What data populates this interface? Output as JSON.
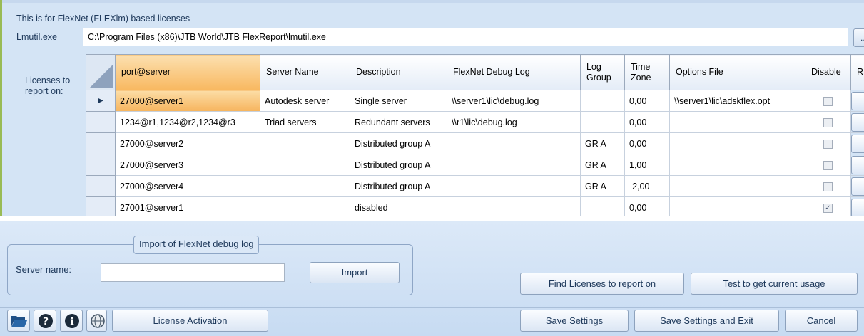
{
  "top": {
    "info_text": "This is for FlexNet (FLEXlm) based licenses",
    "lmutil_label": "Lmutil.exe",
    "lmutil_path": "C:\\Program Files (x86)\\JTB World\\JTB FlexReport\\lmutil.exe",
    "browse_label": "...",
    "licenses_label_line1": "Licenses to",
    "licenses_label_line2": "report on:"
  },
  "grid": {
    "columns": [
      {
        "line1": "port@server",
        "line2": ""
      },
      {
        "line1": "Server Name",
        "line2": ""
      },
      {
        "line1": "Description",
        "line2": ""
      },
      {
        "line1": "FlexNet Debug Log",
        "line2": ""
      },
      {
        "line1": "Log",
        "line2": "Group"
      },
      {
        "line1": "Time",
        "line2": "Zone"
      },
      {
        "line1": "Options File",
        "line2": ""
      },
      {
        "line1": "Disable",
        "line2": ""
      },
      {
        "line1": "R",
        "line2": ""
      }
    ],
    "rows": [
      {
        "port": "27000@server1",
        "server": "Autodesk server",
        "desc": "Single server",
        "log": "\\\\server1\\lic\\debug.log",
        "group": "",
        "tz": "0,00",
        "options": "\\\\server1\\lic\\adskflex.opt",
        "disabled": false
      },
      {
        "port": "1234@r1,1234@r2,1234@r3",
        "server": "Triad servers",
        "desc": "Redundant servers",
        "log": "\\\\r1\\lic\\debug.log",
        "group": "",
        "tz": "0,00",
        "options": "",
        "disabled": false
      },
      {
        "port": "27000@server2",
        "server": "",
        "desc": "Distributed group A",
        "log": "",
        "group": "GR A",
        "tz": "0,00",
        "options": "",
        "disabled": false
      },
      {
        "port": "27000@server3",
        "server": "",
        "desc": "Distributed group A",
        "log": "",
        "group": "GR A",
        "tz": "1,00",
        "options": "",
        "disabled": false
      },
      {
        "port": "27000@server4",
        "server": "",
        "desc": "Distributed group A",
        "log": "",
        "group": "GR A",
        "tz": "-2,00",
        "options": "",
        "disabled": false
      },
      {
        "port": "27001@server1",
        "server": "",
        "desc": "disabled",
        "log": "",
        "group": "",
        "tz": "0,00",
        "options": "",
        "disabled": true
      }
    ]
  },
  "import": {
    "legend": "Import of FlexNet debug log",
    "server_label": "Server name:",
    "server_value": "",
    "import_button": "Import"
  },
  "actions": {
    "find_licenses": "Find Licenses to report on",
    "test_usage": "Test to get current usage"
  },
  "bottom": {
    "activation_first": "L",
    "activation_rest": "icense Activation",
    "save_settings": "Save Settings",
    "save_and_exit": "Save Settings and Exit",
    "cancel": "Cancel"
  },
  "icons": [
    "folder-open-icon",
    "help-icon",
    "info-icon",
    "jtb-world-logo-icon"
  ],
  "colors": {
    "accent": "#f6b45e",
    "panel": "#d4e4f5",
    "text": "#1e395b"
  }
}
